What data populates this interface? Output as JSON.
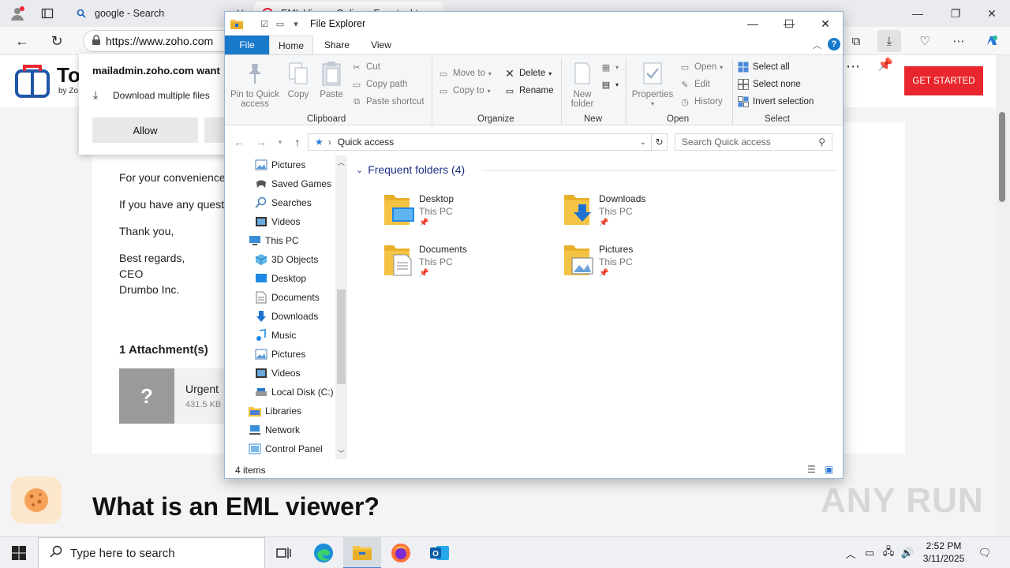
{
  "browser": {
    "tabs": [
      {
        "label": "google - Search"
      },
      {
        "label": "EML Viewer Online - Free tool to..."
      }
    ],
    "url": "https://www.zoho.com"
  },
  "page": {
    "logo_text": "To",
    "logo_sub": "by Zo",
    "get_started": "GET STARTED",
    "email_lines": [
      "For your convenience",
      "If you have any quest",
      "Thank you,",
      "Best regards,",
      "CEO",
      "Drumbo Inc."
    ],
    "attachments_title": "1 Attachment(s)",
    "attachment": {
      "thumb": "?",
      "name": "Urgent",
      "size": "431.5 KB"
    },
    "faq_heading": "What is an EML viewer?"
  },
  "download_popup": {
    "title": "mailadmin.zoho.com want",
    "message": "Download multiple files",
    "allow": "Allow"
  },
  "explorer": {
    "title": "File Explorer",
    "tabs": [
      "File",
      "Home",
      "Share",
      "View"
    ],
    "ribbon": {
      "clipboard": {
        "label": "Clipboard",
        "pin_line1": "Pin to Quick",
        "pin_line2": "access",
        "copy": "Copy",
        "paste": "Paste",
        "cut": "Cut",
        "copy_path": "Copy path",
        "paste_shortcut": "Paste shortcut"
      },
      "organize": {
        "label": "Organize",
        "move_to": "Move to",
        "copy_to": "Copy to",
        "delete": "Delete",
        "rename": "Rename"
      },
      "new": {
        "label": "New",
        "new_folder_line1": "New",
        "new_folder_line2": "folder"
      },
      "open": {
        "label": "Open",
        "properties": "Properties",
        "open": "Open",
        "edit": "Edit",
        "history": "History"
      },
      "select": {
        "label": "Select",
        "select_all": "Select all",
        "select_none": "Select none",
        "invert": "Invert selection"
      }
    },
    "path": "Quick access",
    "search_placeholder": "Search Quick access",
    "nav_items": [
      {
        "label": "Pictures",
        "icon": "pictures-icon"
      },
      {
        "label": "Saved Games",
        "icon": "saved-games-icon"
      },
      {
        "label": "Searches",
        "icon": "searches-icon"
      },
      {
        "label": "Videos",
        "icon": "videos-icon"
      },
      {
        "label": "This PC",
        "icon": "this-pc-icon"
      },
      {
        "label": "3D Objects",
        "icon": "3d-objects-icon"
      },
      {
        "label": "Desktop",
        "icon": "desktop-icon"
      },
      {
        "label": "Documents",
        "icon": "documents-icon"
      },
      {
        "label": "Downloads",
        "icon": "downloads-icon"
      },
      {
        "label": "Music",
        "icon": "music-icon"
      },
      {
        "label": "Pictures",
        "icon": "pictures-icon"
      },
      {
        "label": "Videos",
        "icon": "videos-icon"
      },
      {
        "label": "Local Disk (C:)",
        "icon": "drive-icon"
      },
      {
        "label": "Libraries",
        "icon": "libraries-icon"
      },
      {
        "label": "Network",
        "icon": "network-icon"
      },
      {
        "label": "Control Panel",
        "icon": "control-panel-icon"
      }
    ],
    "group_title": "Frequent folders (4)",
    "folders": [
      {
        "name": "Desktop",
        "location": "This PC"
      },
      {
        "name": "Downloads",
        "location": "This PC"
      },
      {
        "name": "Documents",
        "location": "This PC"
      },
      {
        "name": "Pictures",
        "location": "This PC"
      }
    ],
    "status": "4 items"
  },
  "taskbar": {
    "search_placeholder": "Type here to search",
    "time": "2:52 PM",
    "date": "3/11/2025"
  },
  "watermark": "ANY RUN",
  "colors": {
    "accent": "#1979ca",
    "cta": "#e9262e",
    "folder": "#f5c344"
  }
}
